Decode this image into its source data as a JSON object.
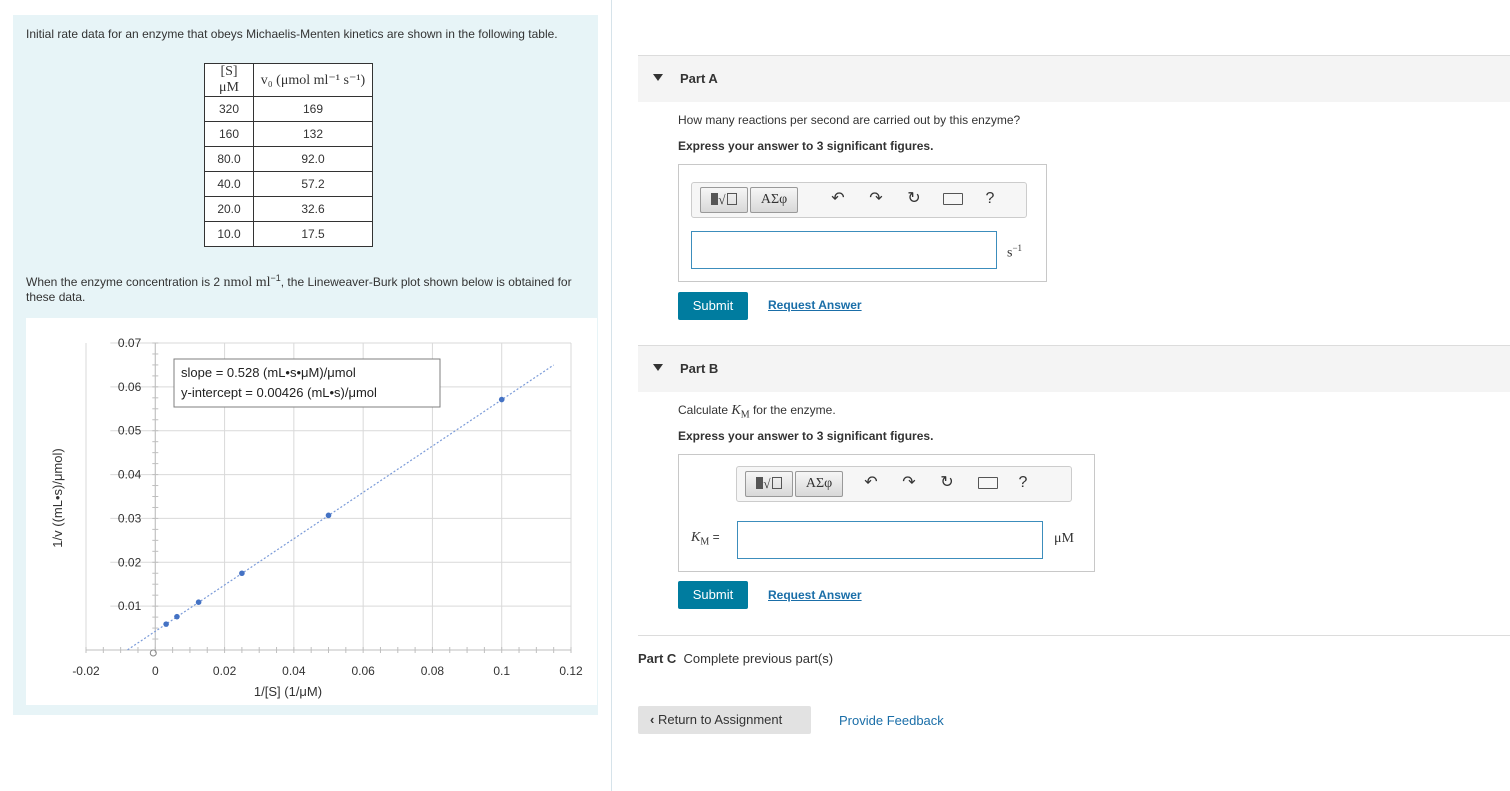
{
  "problem": {
    "intro": "Initial rate data for an enzyme that obeys Michaelis-Menten kinetics are shown in the following table.",
    "table": {
      "headers": [
        "[S] μM",
        "v₀ (μmol ml⁻¹ s⁻¹)"
      ],
      "rows": [
        [
          "320",
          "169"
        ],
        [
          "160",
          "132"
        ],
        [
          "80.0",
          "92.0"
        ],
        [
          "40.0",
          "57.2"
        ],
        [
          "20.0",
          "32.6"
        ],
        [
          "10.0",
          "17.5"
        ]
      ]
    },
    "note_pre": "When the enzyme concentration is 2 ",
    "note_math": "nmol ml",
    "note_sup": "−1",
    "note_post": ", the Lineweaver-Burk plot shown below is obtained for these data."
  },
  "chart_data": {
    "type": "scatter",
    "xlabel": "1/[S] (1/μM)",
    "ylabel": "1/v ((mL•s)/μmol)",
    "xlim": [
      -0.02,
      0.12
    ],
    "ylim": [
      0,
      0.07
    ],
    "xticks": [
      "-0.02",
      "0",
      "0.02",
      "0.04",
      "0.06",
      "0.08",
      "0.1",
      "0.12"
    ],
    "yticks": [
      "0.01",
      "0.02",
      "0.03",
      "0.04",
      "0.05",
      "0.06",
      "0.07"
    ],
    "annotation": [
      "slope = 0.528 (mL•s•μM)/μmol",
      "y-intercept = 0.00426 (mL•s)/μmol"
    ],
    "points": [
      {
        "x": 0.003125,
        "y": 0.0059
      },
      {
        "x": 0.00625,
        "y": 0.0076
      },
      {
        "x": 0.0125,
        "y": 0.0109
      },
      {
        "x": 0.025,
        "y": 0.0175
      },
      {
        "x": 0.05,
        "y": 0.0307
      },
      {
        "x": 0.1,
        "y": 0.0571
      }
    ],
    "fit": {
      "slope": 0.528,
      "intercept": 0.00426
    },
    "colors": {
      "points": "#4472c4",
      "line": "#7a9ad8",
      "grid": "#d9d9d9"
    }
  },
  "partA": {
    "label": "Part A",
    "question": "How many reactions per second are carried out by this enzyme?",
    "hint": "Express your answer to 3 significant figures.",
    "unit_base": "s",
    "unit_sup": "−1",
    "submit": "Submit",
    "request": "Request Answer",
    "toolbar_greek": "ΑΣφ",
    "toolbar_help": "?"
  },
  "partB": {
    "label": "Part B",
    "question_pre": "Calculate ",
    "question_var": "K",
    "question_sub": "M",
    "question_post": " for the enzyme.",
    "hint": "Express your answer to 3 significant figures.",
    "field_var": "K",
    "field_sub": "M",
    "field_eq": " =",
    "unit": "μM",
    "submit": "Submit",
    "request": "Request Answer",
    "toolbar_greek": "ΑΣφ",
    "toolbar_help": "?"
  },
  "partC": {
    "label": "Part C",
    "text": "Complete previous part(s)"
  },
  "footer": {
    "return": "Return to Assignment",
    "feedback": "Provide Feedback"
  }
}
